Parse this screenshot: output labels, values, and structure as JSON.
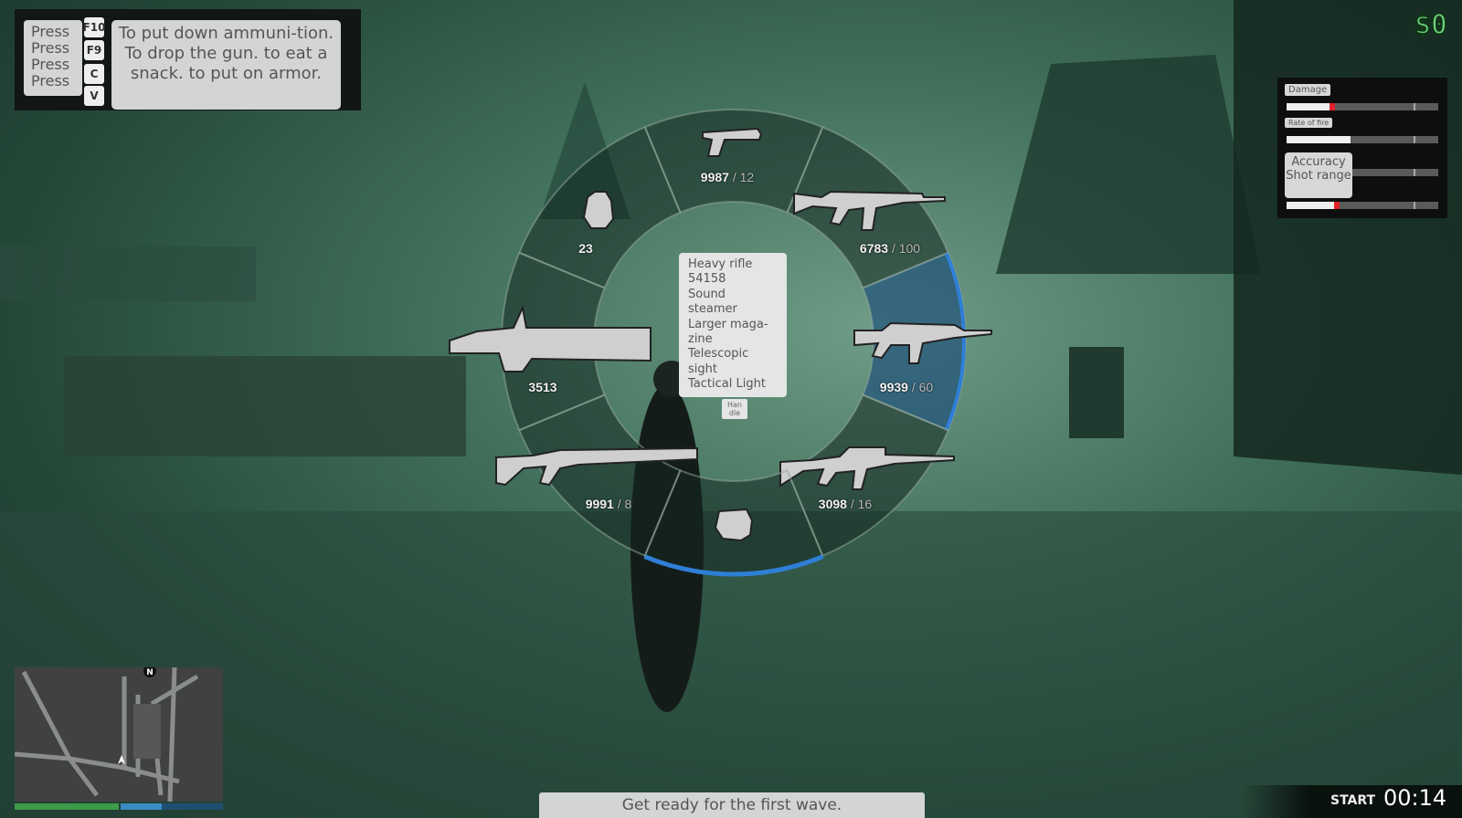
{
  "help": {
    "press_labels": [
      "Press",
      "Press",
      "Press",
      "Press"
    ],
    "keys": [
      "F10",
      "F9",
      "C",
      "V"
    ],
    "text_line1": "To put down ammuni-tion.",
    "text_line2": "To drop the gun. to eat a snack. to put on armor."
  },
  "money": "$0",
  "stats": {
    "damage_label": "Damage",
    "damage_level": 0.3,
    "rate_label": "Rate of fire",
    "rate_level": 0.42,
    "accuracy_label": "Accuracy Shot range",
    "accuracy_level": 0.3,
    "range_level": 0.33,
    "compare_marker": 0.84
  },
  "wheel": {
    "selected": "heavy-rifle",
    "accent": "#2f7fd6",
    "slots": [
      {
        "id": "pistol",
        "icon": "pistol-icon",
        "ammo": "9987",
        "clip": "/ 12"
      },
      {
        "id": "rifle",
        "icon": "assault-rifle-icon",
        "ammo": "6783",
        "clip": "/ 100"
      },
      {
        "id": "heavy-rifle",
        "icon": "heavy-rifle-icon",
        "ammo": "9939",
        "clip": "/ 60"
      },
      {
        "id": "sniper",
        "icon": "sniper-rifle-icon",
        "ammo": "3098",
        "clip": "/ 16"
      },
      {
        "id": "fist",
        "icon": "fist-icon",
        "ammo": "",
        "clip": ""
      },
      {
        "id": "shotgun",
        "icon": "shotgun-icon",
        "ammo": "9991",
        "clip": "/ 8"
      },
      {
        "id": "minigun",
        "icon": "minigun-icon",
        "ammo": "3513",
        "clip": ""
      },
      {
        "id": "grenade",
        "icon": "grenade-icon",
        "ammo": "23",
        "clip": ""
      }
    ]
  },
  "tooltip": {
    "lines": [
      "Heavy rifle",
      "54158",
      "Sound",
      "steamer",
      "Larger maga-",
      "zine",
      "Telescopic",
      "sight",
      "Tactical Light"
    ],
    "handle": "Han dle"
  },
  "minimap": {
    "north": "N",
    "health_color": "#3d9a4a",
    "armor_color": "#3a8cc4"
  },
  "objective": "Get ready for the first wave.",
  "timer": {
    "label": "START",
    "value": "00:14"
  }
}
